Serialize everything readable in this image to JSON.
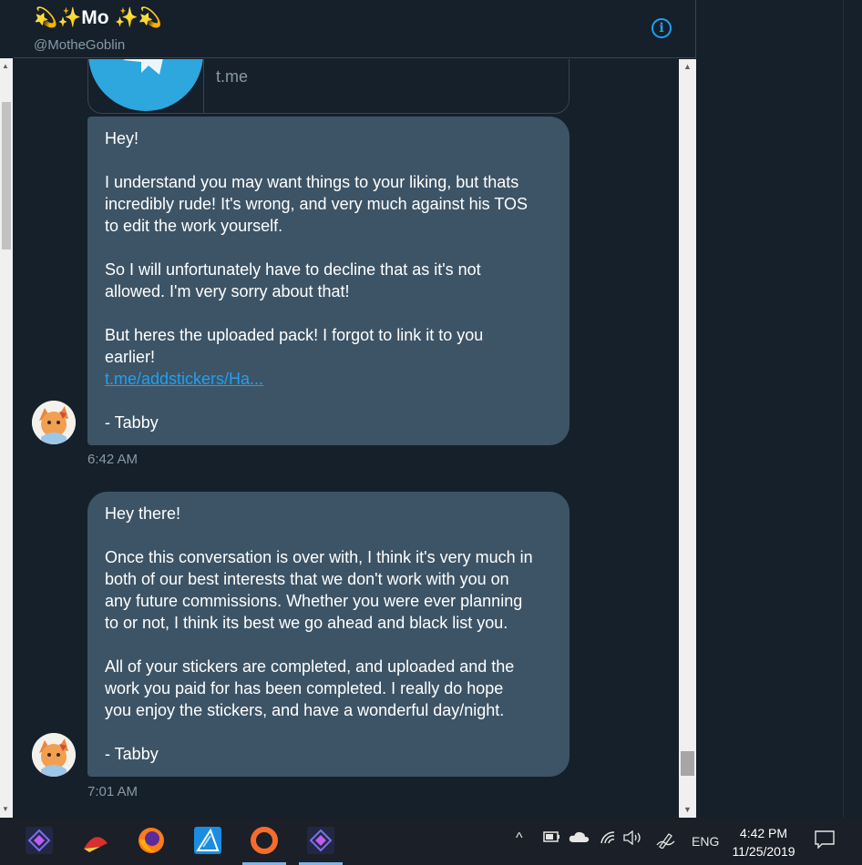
{
  "header": {
    "display_name": "Mo",
    "name_emoji_left": "💫✨",
    "name_emoji_right": "✨💫",
    "handle": "@MotheGoblin",
    "info_glyph": "i"
  },
  "link_card": {
    "url": "t.me",
    "icon": "telegram-icon"
  },
  "messages": [
    {
      "lines": [
        "Hey!",
        "",
        "I understand you may want things to your liking, but thats",
        "incredibly rude! It's wrong, and very much against his TOS",
        "to edit the work yourself.",
        "",
        "So I will unfortunately have to decline that as it's not",
        "allowed. I'm very sorry about that!",
        "",
        "But heres the uploaded pack! I forgot to link it to you",
        "earlier!"
      ],
      "link": "t.me/addstickers/Ha...",
      "signoff_blank": "",
      "signoff": "- Tabby",
      "time": "6:42 AM"
    },
    {
      "lines": [
        "Hey there!",
        "",
        "Once this conversation is over with, I think it's very much in",
        "both of our best interests that we don't work with you on",
        "any future commissions. Whether you were ever planning",
        "to or not, I think its best we go ahead and black list you.",
        "",
        "All of your stickers are completed, and uploaded and the",
        "work you paid for has been completed. I really do hope",
        "you enjoy the stickers, and have a wonderful day/night.",
        ""
      ],
      "signoff": "- Tabby",
      "time": "7:01 AM"
    }
  ],
  "taskbar": {
    "apps": [
      "affinity-photo-icon",
      "cutting-app-icon",
      "firefox-icon",
      "affinity-designer-icon",
      "origin-icon",
      "affinity-photo-icon"
    ],
    "tray": {
      "chevron": "^",
      "language": "ENG",
      "time": "4:42 PM",
      "date": "11/25/2019"
    }
  },
  "colors": {
    "background": "#15202b",
    "bubble": "#3d5466",
    "link": "#1da1f2",
    "muted": "#8899a6"
  }
}
